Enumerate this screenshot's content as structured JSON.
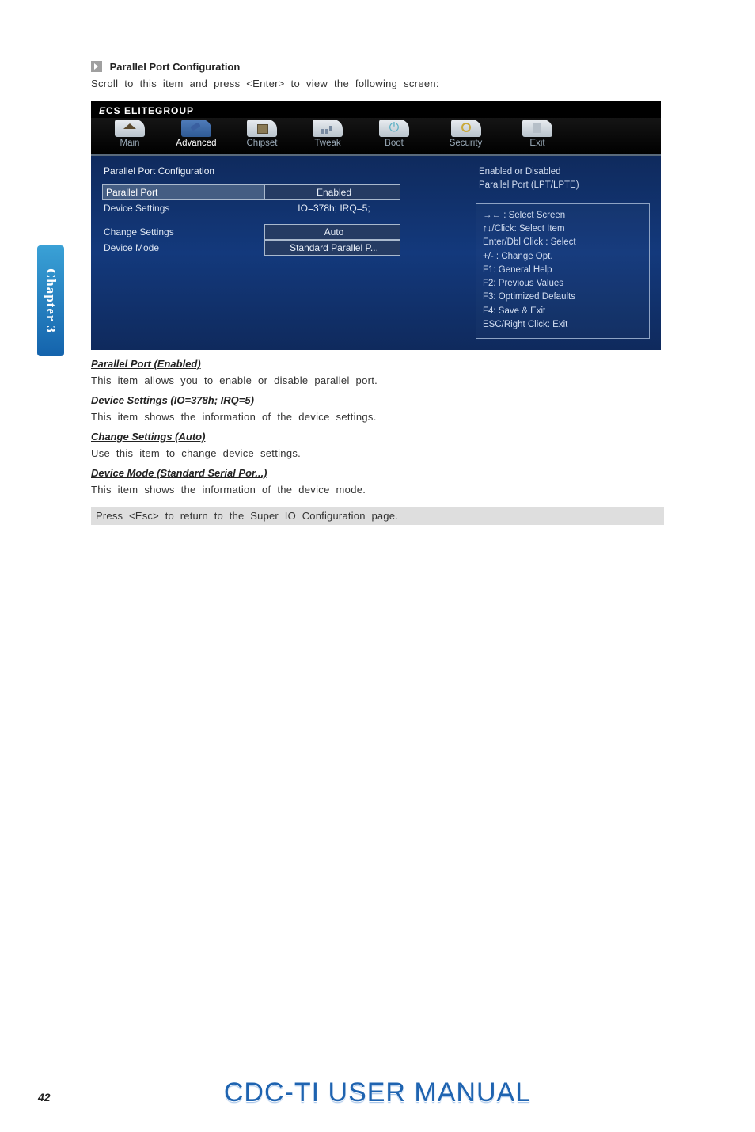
{
  "section": {
    "caret_title": "Parallel Port Configuration",
    "scroll_hint": "Scroll to this item and press <Enter> to view the following screen:"
  },
  "bios": {
    "brand": "ELITEGROUP",
    "tabs": {
      "main": "Main",
      "advanced": "Advanced",
      "chipset": "Chipset",
      "tweak": "Tweak",
      "boot": "Boot",
      "security": "Security",
      "exit": "Exit"
    },
    "heading": "Parallel Port Configuration",
    "rows": {
      "parallel_port": {
        "label": "Parallel Port",
        "value": "Enabled"
      },
      "device_settings": {
        "label": "Device Settings",
        "value": "IO=378h; IRQ=5;"
      },
      "change_settings": {
        "label": "Change Settings",
        "value": "Auto"
      },
      "device_mode": {
        "label": "Device Mode",
        "value": "Standard Parallel P..."
      }
    },
    "help": {
      "line1": "Enabled or Disabled",
      "line2": "Parallel Port (LPT/LPTE)",
      "k_select_screen": "→←    : Select Screen",
      "k_select_item": "↑↓/Click: Select Item",
      "k_enter": "Enter/Dbl Click : Select",
      "k_change": "+/- : Change Opt.",
      "k_f1": "F1: General Help",
      "k_f2": "F2: Previous Values",
      "k_f3": "F3: Optimized Defaults",
      "k_f4": "F4: Save & Exit",
      "k_esc": "ESC/Right Click: Exit"
    }
  },
  "content": {
    "h1": "Parallel Port (Enabled)",
    "p1": "This item allows you to enable or disable parallel port.",
    "h2": "Device Settings (IO=378h; IRQ=5)",
    "p2": "This item shows the information of the device settings.",
    "h3": "Change Settings (Auto)",
    "p3": "Use this item to change device settings.",
    "h4": "Device Mode (Standard Serial Por...)",
    "p4": "This item shows the information of the device mode.",
    "note": "Press <Esc> to return to the Super IO Configuration page."
  },
  "sidetab": "Chapter 3",
  "footer": "CDC-TI USER MANUAL",
  "page": "42"
}
